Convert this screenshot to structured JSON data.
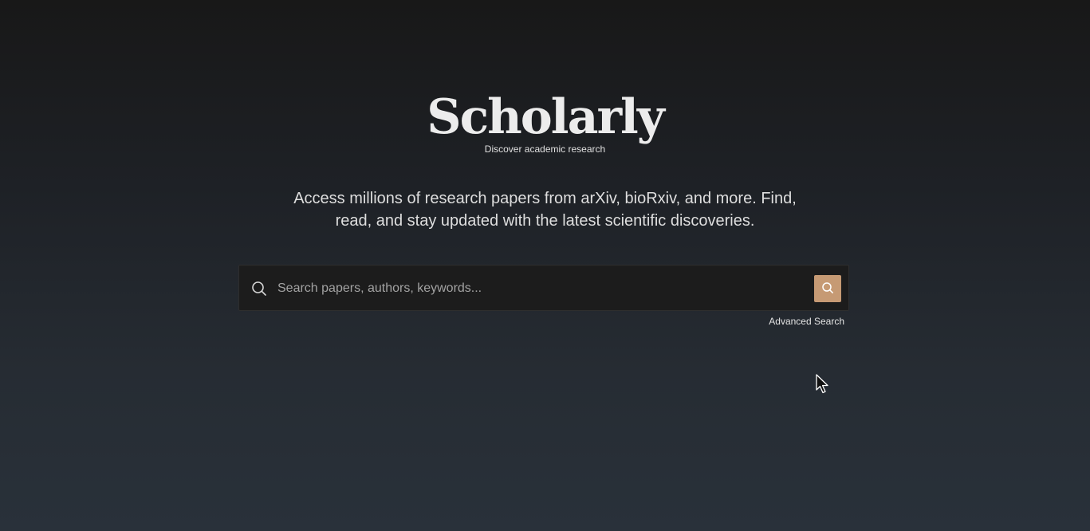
{
  "brand": {
    "title": "Scholarly",
    "subtitle": "Discover academic research"
  },
  "tagline": {
    "line1": "Access millions of research papers from arXiv, bioRxiv, and more. Find,",
    "line2": "read, and stay updated with the latest scientific discoveries."
  },
  "search": {
    "placeholder": "Search papers, authors, keywords...",
    "value": "",
    "icon": "search-icon",
    "button_icon": "search-icon",
    "button_color": "#c69a74"
  },
  "advanced_search": {
    "label": "Advanced Search"
  },
  "colors": {
    "background_top": "#181818",
    "background_bottom": "#29313a",
    "accent": "#c69a74",
    "text": "#e6e6e6"
  }
}
